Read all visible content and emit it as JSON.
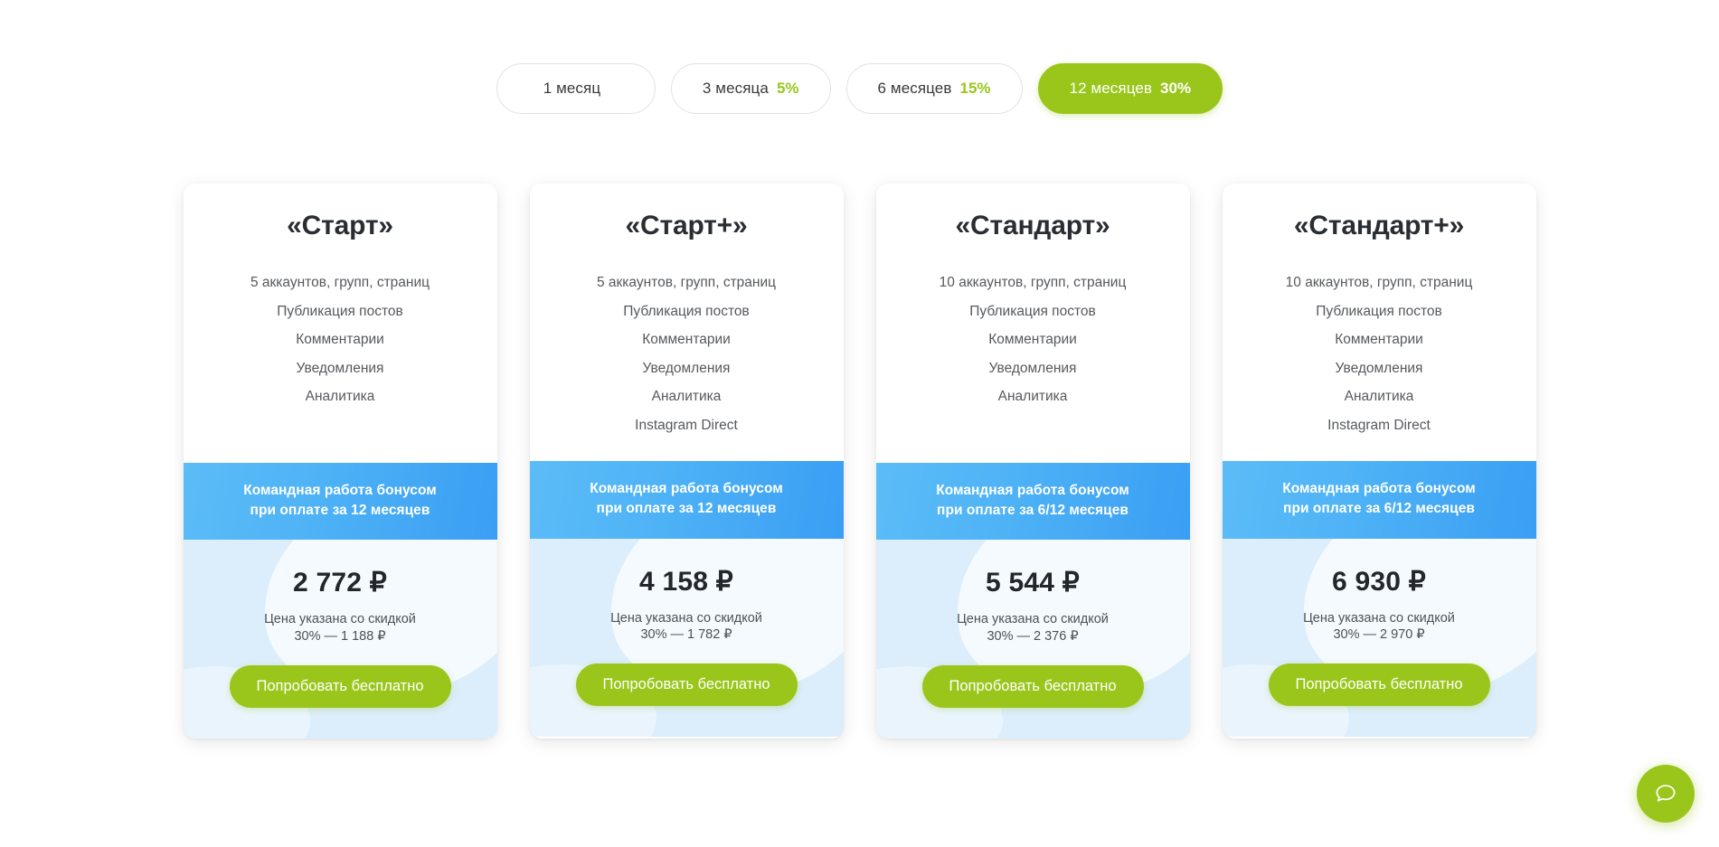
{
  "colors": {
    "accent_green": "#9ac61c",
    "banner_blue_start": "#5bbcf7",
    "banner_blue_end": "#3a9ef4",
    "bottom_blue": "#dcedfb",
    "title_dark": "#2a2e33"
  },
  "period_tabs": [
    {
      "label": "1 месяц",
      "discount": "",
      "active": false
    },
    {
      "label": "3 месяца",
      "discount": "5%",
      "active": false
    },
    {
      "label": "6 месяцев",
      "discount": "15%",
      "active": false
    },
    {
      "label": "12 месяцев",
      "discount": "30%",
      "active": true
    }
  ],
  "plans": [
    {
      "title": "«Старт»",
      "features": [
        "5 аккаунтов, групп, страниц",
        "Публикация постов",
        "Комментарии",
        "Уведомления",
        "Аналитика"
      ],
      "banner_line1": "Командная работа бонусом",
      "banner_line2": "при оплате за 12 месяцев",
      "price": "2 772 ₽",
      "note_line1": "Цена указана со скидкой",
      "note_line2": "30% — 1 188 ₽",
      "cta": "Попробовать бесплатно"
    },
    {
      "title": "«Старт+»",
      "features": [
        "5 аккаунтов, групп, страниц",
        "Публикация постов",
        "Комментарии",
        "Уведомления",
        "Аналитика",
        "Instagram Direct"
      ],
      "banner_line1": "Командная работа бонусом",
      "banner_line2": "при оплате за 12 месяцев",
      "price": "4 158 ₽",
      "note_line1": "Цена указана со скидкой",
      "note_line2": "30% — 1 782 ₽",
      "cta": "Попробовать бесплатно"
    },
    {
      "title": "«Стандарт»",
      "features": [
        "10 аккаунтов, групп, страниц",
        "Публикация постов",
        "Комментарии",
        "Уведомления",
        "Аналитика"
      ],
      "banner_line1": "Командная работа бонусом",
      "banner_line2": "при оплате за 6/12 месяцев",
      "price": "5 544 ₽",
      "note_line1": "Цена указана со скидкой",
      "note_line2": "30% — 2 376 ₽",
      "cta": "Попробовать бесплатно"
    },
    {
      "title": "«Стандарт+»",
      "features": [
        "10 аккаунтов, групп, страниц",
        "Публикация постов",
        "Комментарии",
        "Уведомления",
        "Аналитика",
        "Instagram Direct"
      ],
      "banner_line1": "Командная работа бонусом",
      "banner_line2": "при оплате за 6/12 месяцев",
      "price": "6 930 ₽",
      "note_line1": "Цена указана со скидкой",
      "note_line2": "30% — 2 970 ₽",
      "cta": "Попробовать бесплатно"
    }
  ],
  "chat_widget": {
    "icon": "chat-bubble-icon"
  }
}
